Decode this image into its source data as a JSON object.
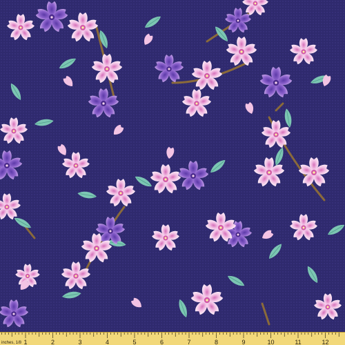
{
  "image": {
    "subject": "cherry-blossom-fabric-swatch",
    "colors": {
      "background": "#2f2a6e",
      "blossom_light": "#f6d3ea",
      "blossom_pink": "#e9a9d6",
      "blossom_violet": "#8b62c8",
      "leaf": "#7cc6b3",
      "branch": "#8a6a3a"
    }
  },
  "ruler": {
    "unit_label": "inches, 1/8",
    "marks": [
      "1",
      "2",
      "3",
      "4",
      "5",
      "6",
      "7",
      "8",
      "9",
      "10",
      "11",
      "12"
    ],
    "color": "#f2d87a"
  }
}
